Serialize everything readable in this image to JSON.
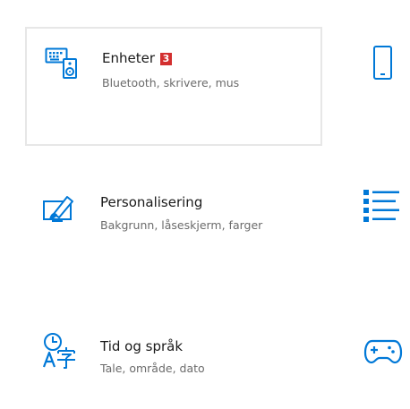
{
  "colors": {
    "accent": "#0078d7",
    "badge": "#d32f2f",
    "title": "#1a1a1a",
    "description": "#6b6b6b",
    "selected_border": "#e7e7e7"
  },
  "tiles": [
    {
      "title": "Enheter",
      "description": "Bluetooth, skrivere, mus",
      "badge": "3",
      "icon": "devices-icon",
      "selected": true
    },
    {
      "title": "Personalisering",
      "description": "Bakgrunn, låseskjerm, farger",
      "icon": "personalization-icon",
      "selected": false
    },
    {
      "title": "Tid og språk",
      "description": "Tale, område, dato",
      "icon": "time-language-icon",
      "selected": false
    }
  ],
  "right_column_icons": [
    "phone-icon",
    "apps-list-icon",
    "gaming-controller-icon"
  ]
}
